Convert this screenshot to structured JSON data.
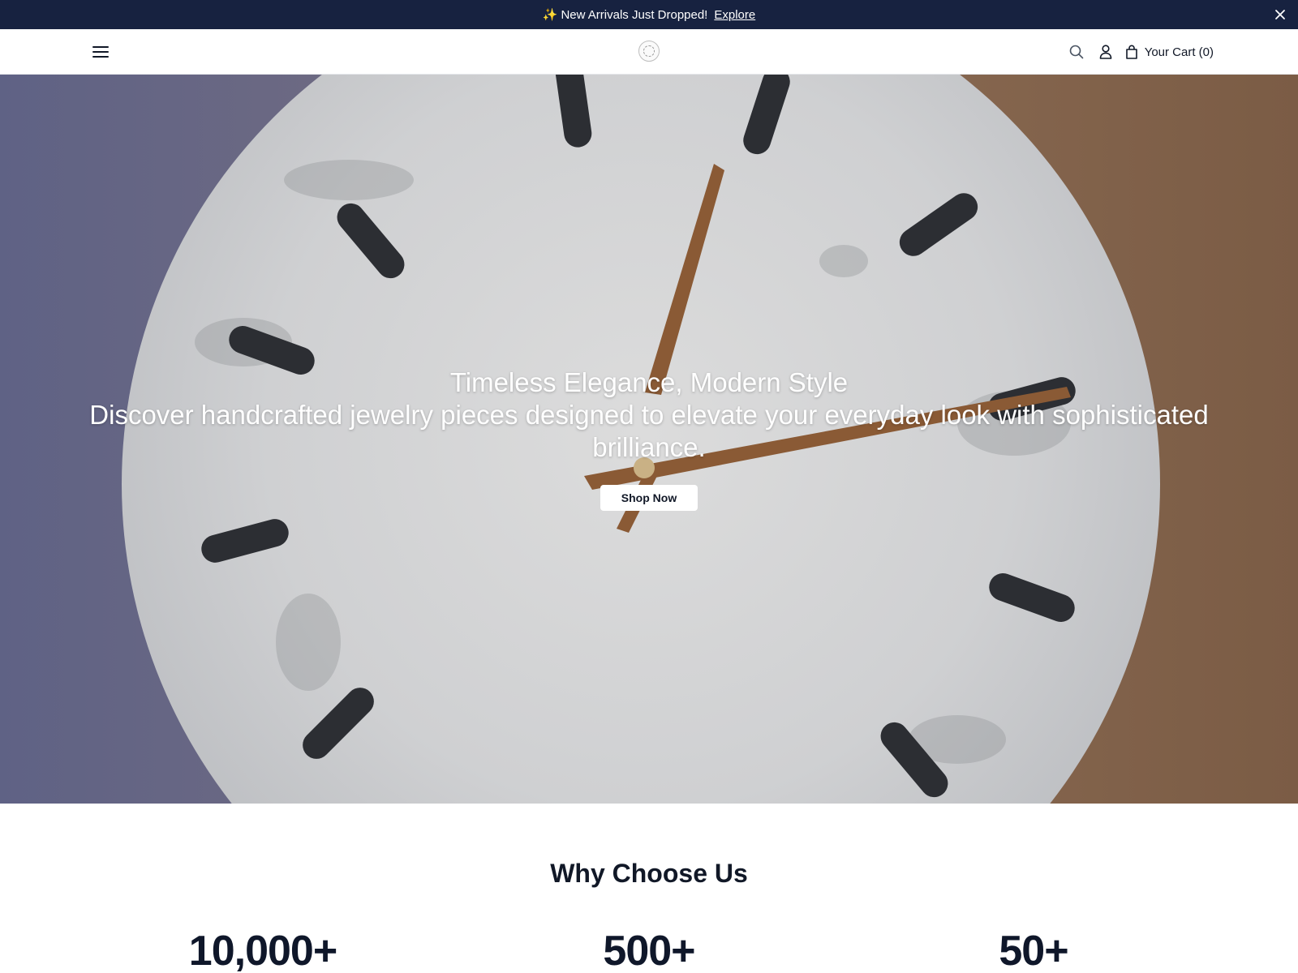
{
  "announcement": {
    "sparkle": "✨",
    "text": "New Arrivals Just Dropped!",
    "link": "Explore"
  },
  "header": {
    "cart_label": "Your Cart (0)"
  },
  "hero": {
    "title": "Timeless Elegance, Modern Style",
    "subtitle": "Discover handcrafted jewelry pieces designed to elevate your everyday look with sophisticated brilliance.",
    "cta": "Shop Now"
  },
  "why": {
    "title": "Why Choose Us",
    "stats": [
      {
        "value": "10,000+"
      },
      {
        "value": "500+"
      },
      {
        "value": "50+"
      }
    ]
  },
  "colors": {
    "announcement_bg": "#172240",
    "text_primary": "#111827"
  }
}
